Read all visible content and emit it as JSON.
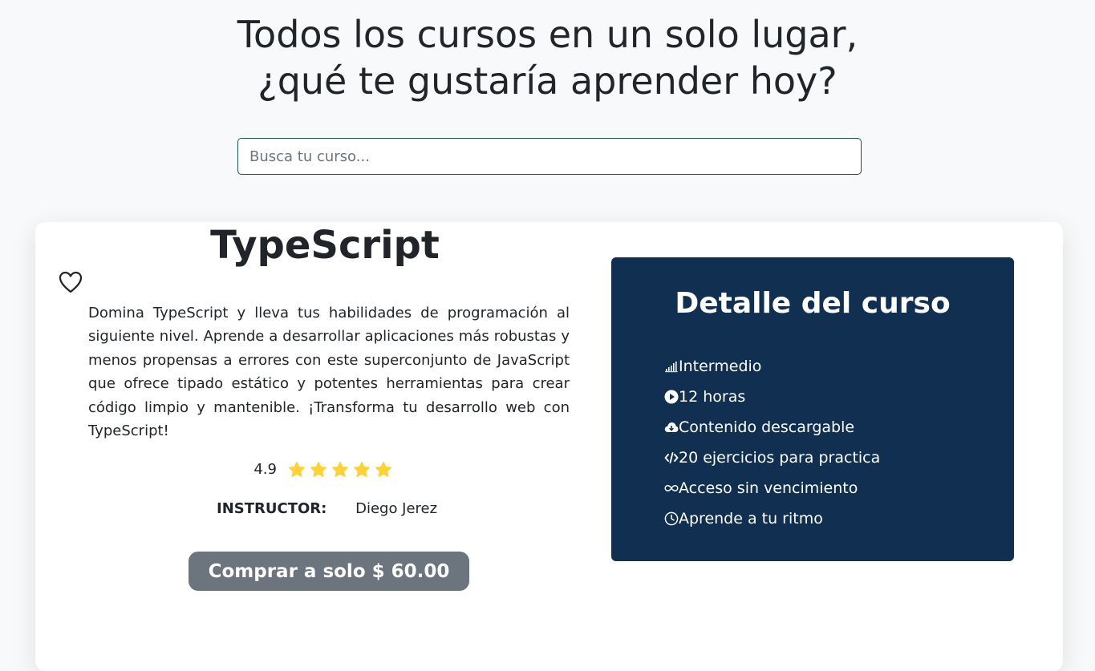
{
  "hero": {
    "title_line1": "Todos los cursos en un solo lugar,",
    "title_line2": "¿qué te gustaría aprender hoy?"
  },
  "search": {
    "placeholder": "Busca tu curso...",
    "value": ""
  },
  "course": {
    "title": "TypeScript",
    "favorite_icon": "heart-outline-icon",
    "description": "Domina TypeScript y lleva tus habilidades de programación al siguiente nivel. Aprende a desarrollar aplicaciones más robustas y menos propensas a errores con este superconjunto de JavaScript que ofrece tipado estático y potentes herramientas para crear código limpio y mantenible. ¡Transforma tu desarrollo web con TypeScript!",
    "rating": "4.9",
    "stars": 5,
    "star_color": "#fdd13a",
    "instructor_label": "INSTRUCTOR:",
    "instructor_name": "Diego Jerez",
    "buy_label": "Comprar a solo $ 60.00"
  },
  "details": {
    "title": "Detalle del curso",
    "bg_color": "#112f51",
    "items": [
      {
        "icon": "signal-bars-icon",
        "label": "Intermedio"
      },
      {
        "icon": "play-circle-icon",
        "label": "12 horas"
      },
      {
        "icon": "cloud-download-icon",
        "label": "Contenido descargable"
      },
      {
        "icon": "code-icon",
        "label": "20 ejercicios para practica"
      },
      {
        "icon": "infinity-icon",
        "label": "Acceso sin vencimiento"
      },
      {
        "icon": "clock-icon",
        "label": "Aprende a tu ritmo"
      }
    ]
  },
  "colors": {
    "button_bg": "#6c757d",
    "search_border": "#1b4d5c"
  }
}
